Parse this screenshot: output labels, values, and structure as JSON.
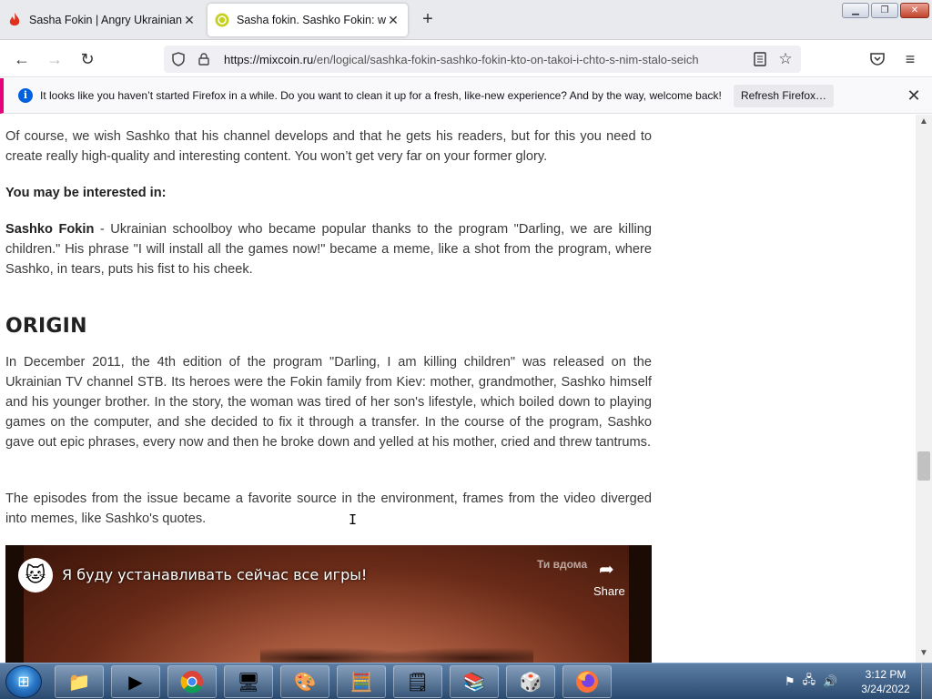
{
  "window": {
    "minimize_label": "▁",
    "maximize_label": "❐",
    "close_label": "✕"
  },
  "tabs": [
    {
      "title": "Sasha Fokin | Angry Ukrainian K",
      "favicon": "fire-icon",
      "close": "✕"
    },
    {
      "title": "Sasha fokin. Sashko Fokin: who",
      "favicon": "mixcoin-icon",
      "close": "✕"
    }
  ],
  "new_tab_label": "+",
  "nav": {
    "back": "←",
    "forward": "→",
    "reload": "↻",
    "url_host": "https://mixcoin.ru",
    "url_path": "/en/logical/sashka-fokin-sashko-fokin-kto-on-takoi-i-chto-s-nim-stalo-seich",
    "pocket": "◙",
    "menu": "≡"
  },
  "notice": {
    "message": "It looks like you haven’t started Firefox in a while. Do you want to clean it up for a fresh, like-new experience? And by the way, welcome back!",
    "refresh_button": "Refresh Firefox…",
    "close": "✕",
    "info_glyph": "i"
  },
  "article": {
    "p1": "Of course, we wish Sashko that his channel develops and that he gets his readers, but for this you need to create really high-quality and interesting content. You won’t get very far on your former glory.",
    "p2": "You may be interested in:",
    "p3_bold": "Sashko Fokin",
    "p3_rest": " - Ukrainian schoolboy who became popular thanks to the program \"Darling, we are killing children.\" His phrase \"I will install all the games now!\" became a meme, like a shot from the program, where Sashko, in tears, puts his fist to his cheek.",
    "heading": "ORIGIN",
    "p4": "In December 2011, the 4th edition of the program \"Darling, I am killing children\" was released on the Ukrainian TV channel STB. Its heroes were the Fokin family from Kiev: mother, grandmother, Sashko himself and his younger brother. In the story, the woman was tired of her son's lifestyle, which boiled down to playing games on the computer, and she decided to fix it through a transfer. In the course of the program, Sashko gave out epic phrases, every now and then he broke down and yelled at his mother, cried and threw tantrums.",
    "p5": "The episodes from the issue became a favorite source in the environment, frames from the video diverged into memes, like Sashko's quotes."
  },
  "video": {
    "title": "Я буду устанавливать сейчас все игры!",
    "channel_watermark": "Ти вдома",
    "share_label": "Share"
  },
  "taskbar": {
    "time": "3:12 PM",
    "date": "3/24/2022"
  },
  "colors": {
    "notice_accent": "#e6007a",
    "info_blue": "#0060df",
    "taskbar": "#2b4a6f"
  }
}
